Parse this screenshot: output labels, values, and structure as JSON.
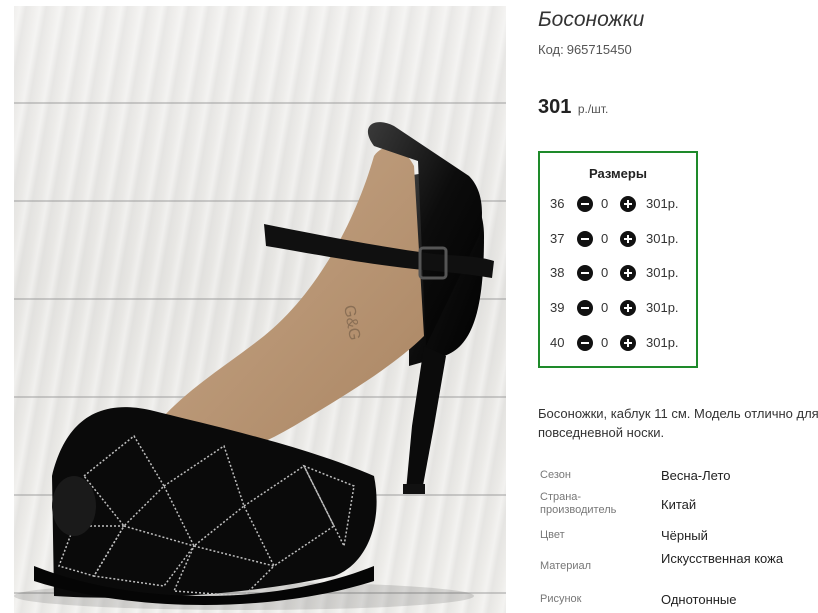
{
  "product": {
    "title": "Босоножки",
    "code_label": "Код:",
    "code_value": "965715450",
    "price_amount": "301",
    "price_unit": "р./шт.",
    "image_icon": "shoe-photo"
  },
  "sizes": {
    "heading": "Размеры",
    "rows": [
      {
        "size": "36",
        "qty": "0",
        "price": "301р."
      },
      {
        "size": "37",
        "qty": "0",
        "price": "301р."
      },
      {
        "size": "38",
        "qty": "0",
        "price": "301р."
      },
      {
        "size": "39",
        "qty": "0",
        "price": "301р."
      },
      {
        "size": "40",
        "qty": "0",
        "price": "301р."
      }
    ],
    "border_color": "#1e8a2a"
  },
  "description": "Босоножки, каблук 11 см. Модель отлично для повседневной носки.",
  "attributes": [
    {
      "key": "Сезон",
      "value": "Весна-Лето"
    },
    {
      "key": "Страна-\nпроизводитель",
      "value": "Китай"
    },
    {
      "key": "Цвет",
      "value": "Чёрный"
    },
    {
      "key": "Материал",
      "value": "Искусственная кожа"
    },
    {
      "key": "Рисунок",
      "value": "Однотонные"
    }
  ]
}
